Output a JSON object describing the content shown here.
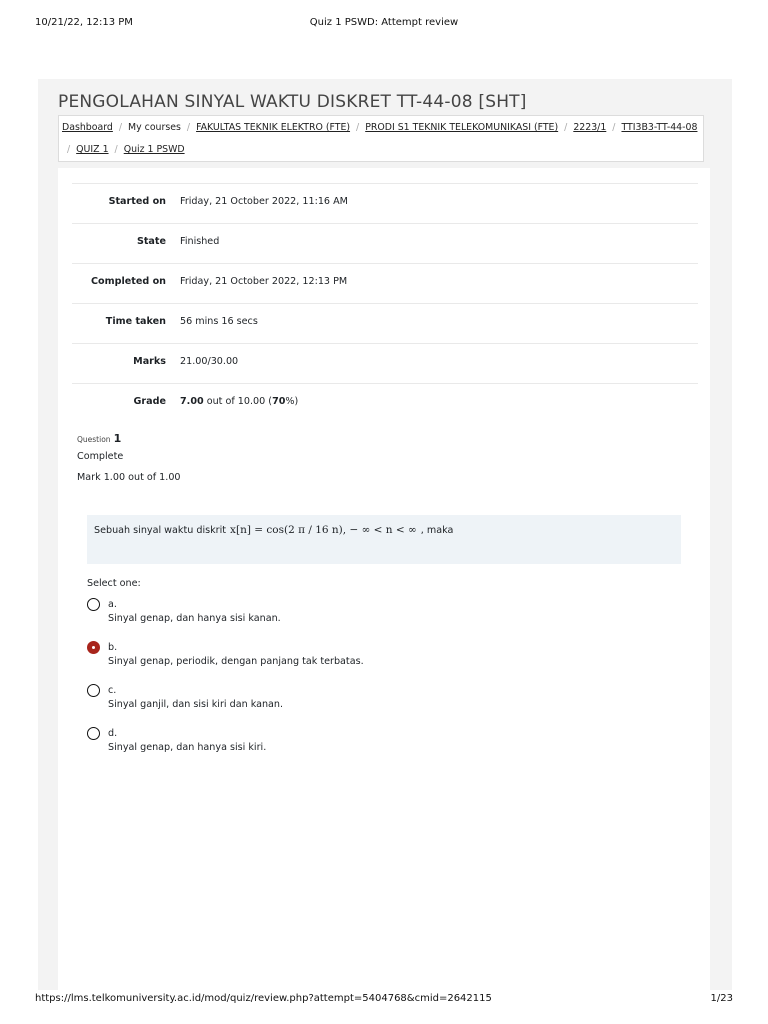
{
  "print": {
    "datetime": "10/21/22, 12:13 PM",
    "doc_title": "Quiz 1 PSWD: Attempt review",
    "url": "https://lms.telkomuniversity.ac.id/mod/quiz/review.php?attempt=5404768&cmid=2642115",
    "page": "1/23"
  },
  "course": {
    "title": "PENGOLAHAN SINYAL WAKTU DISKRET TT-44-08 [SHT]"
  },
  "breadcrumb": {
    "items": [
      "Dashboard",
      "My courses",
      "FAKULTAS TEKNIK ELEKTRO (FTE)",
      "PRODI S1 TEKNIK TELEKOMUNIKASI (FTE)",
      "2223/1",
      "TTI3B3-TT-44-08",
      "QUIZ 1",
      "Quiz 1 PSWD"
    ]
  },
  "summary": {
    "started_label": "Started on",
    "started_value": "Friday, 21 October 2022, 11:16 AM",
    "state_label": "State",
    "state_value": "Finished",
    "completed_label": "Completed on",
    "completed_value": "Friday, 21 October 2022, 12:13 PM",
    "time_label": "Time taken",
    "time_value": "56 mins 16 secs",
    "marks_label": "Marks",
    "marks_value": "21.00/30.00",
    "grade_label": "Grade",
    "grade_score": "7.00",
    "grade_mid": "out of 10.00 (",
    "grade_pct": "70",
    "grade_end": "%)"
  },
  "question": {
    "label": "Question",
    "number": "1",
    "state": "Complete",
    "mark": "Mark 1.00 out of 1.00",
    "text_before": "Sebuah sinyal waktu diskrit",
    "formula": "x[n] = cos(2 π / 16 n), − ∞ < n < ∞",
    "text_after": ", maka",
    "select_label": "Select one:",
    "options": [
      {
        "letter": "a.",
        "text": "Sinyal genap, dan hanya sisi kanan.",
        "selected": false
      },
      {
        "letter": "b.",
        "text": "Sinyal genap, periodik, dengan panjang tak terbatas.",
        "selected": true
      },
      {
        "letter": "c.",
        "text": "Sinyal ganjil, dan sisi kiri dan kanan.",
        "selected": false
      },
      {
        "letter": "d.",
        "text": "Sinyal genap, dan hanya sisi kiri.",
        "selected": false
      }
    ]
  },
  "colors": {
    "selected_radio": "#a8251c",
    "question_box": "#eef3f7"
  }
}
